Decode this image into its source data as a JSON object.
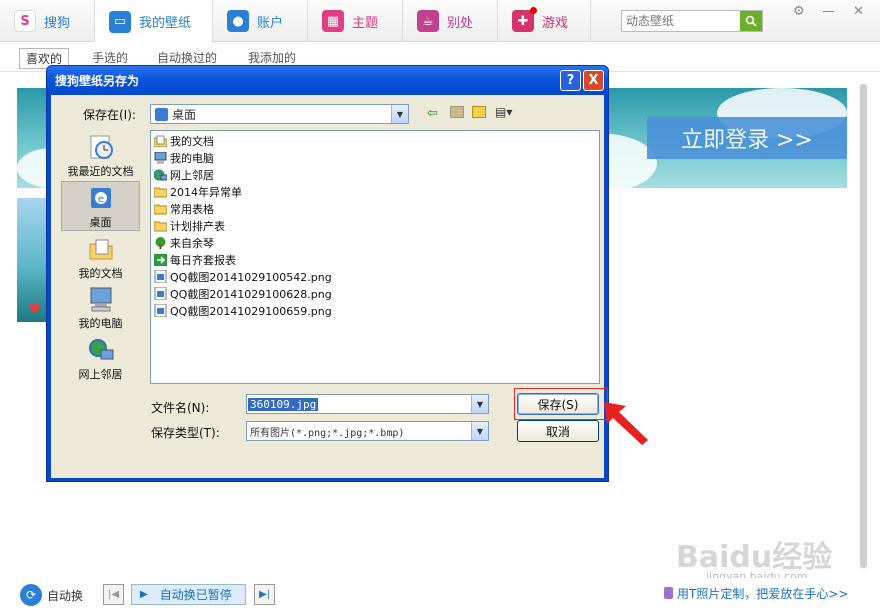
{
  "topbar": {
    "tabs": [
      {
        "label": "搜狗",
        "icon": "sogou-logo-icon",
        "color": "#e8e8e8"
      },
      {
        "label": "我的壁纸",
        "icon": "monitor-icon",
        "color": "#2b7fd6"
      },
      {
        "label": "账户",
        "icon": "user-icon",
        "color": "#2b7fd6"
      },
      {
        "label": "主题",
        "icon": "theme-icon",
        "color": "#e23d87"
      },
      {
        "label": "别处",
        "icon": "cup-icon",
        "color": "#c3418c"
      },
      {
        "label": "游戏",
        "icon": "gamepad-icon",
        "color": "#d6336c"
      }
    ],
    "search_placeholder": "动态壁纸"
  },
  "subnav": {
    "tabs": [
      "喜欢的",
      "手选的",
      "自动换过的",
      "我添加的"
    ]
  },
  "banner": {
    "login_label": "立即登录 >>"
  },
  "bottom": {
    "auto_label": "自动换",
    "paused_label": "自动换已暂停",
    "promo": "用T",
    "promo_rest": "照片定制，把爱放在手心>>"
  },
  "watermark": {
    "text": "Baidu经验",
    "sub": "jingyan.baidu.com"
  },
  "dialog": {
    "title": "搜狗壁纸另存为",
    "save_in_label": "保存在(I):",
    "location": "桌面",
    "places": [
      "我最近的文档",
      "桌面",
      "我的文档",
      "我的电脑",
      "网上邻居"
    ],
    "files": [
      {
        "name": "我的文档",
        "icon": "folder-docs-icon"
      },
      {
        "name": "我的电脑",
        "icon": "computer-icon"
      },
      {
        "name": "网上邻居",
        "icon": "network-icon"
      },
      {
        "name": "2014年异常单",
        "icon": "folder-icon"
      },
      {
        "name": "常用表格",
        "icon": "folder-icon"
      },
      {
        "name": "计划排产表",
        "icon": "folder-icon"
      },
      {
        "name": "来自余琴",
        "icon": "tree-icon"
      },
      {
        "name": "每日齐套报表",
        "icon": "shortcut-icon"
      },
      {
        "name": "QQ截图20141029100542.png",
        "icon": "image-file-icon"
      },
      {
        "name": "QQ截图20141029100628.png",
        "icon": "image-file-icon"
      },
      {
        "name": "QQ截图20141029100659.png",
        "icon": "image-file-icon"
      }
    ],
    "filename_label": "文件名(N):",
    "filename_value": "360109.jpg",
    "filetype_label": "保存类型(T):",
    "filetype_value": "所有图片(*.png;*.jpg;*.bmp)",
    "save_button": "保存(S)",
    "cancel_button": "取消",
    "help": "?",
    "close": "X"
  }
}
